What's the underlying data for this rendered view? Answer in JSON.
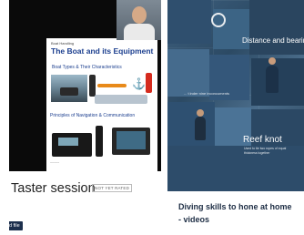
{
  "left_card": {
    "slide": {
      "small_label": "Boat Handling",
      "title": "The Boat and its Equipment",
      "subtitle_1": "Boat Types & Their Characteristics",
      "subtitle_2": "Principles of Navigation & Communication",
      "footer_note": "~~~~~"
    },
    "title": "Taster session",
    "rating_badge": "NOT YET RATED",
    "find_button": "nd file"
  },
  "right_card": {
    "mosaic_labels": {
      "distance": "Distance and bearin",
      "ml2": "... t inder nine inconcuments",
      "reef_knot": "Reef knot",
      "reef_desc_1": "Used to tie two ropes of equal",
      "reef_desc_2": "thickness together"
    },
    "title_line_1": "Diving skills to hone at home",
    "title_line_2": "- videos"
  }
}
